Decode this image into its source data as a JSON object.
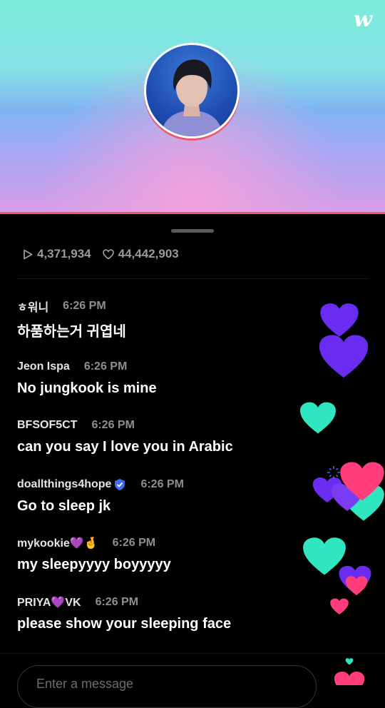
{
  "app": {
    "logo": "w"
  },
  "stats": {
    "plays": "4,371,934",
    "likes": "44,442,903"
  },
  "messages": [
    {
      "user": "ㅎ워니",
      "time": "6:26 PM",
      "text": "하품하는거 귀엽네"
    },
    {
      "user": "Jeon Ispa",
      "time": "6:26 PM",
      "text": "No jungkook is mine"
    },
    {
      "user": "BFSOF5CT",
      "time": "6:26 PM",
      "text": "can you say I love you in Arabic"
    },
    {
      "user": "doallthings4hope",
      "time": "6:26 PM",
      "text": "Go to sleep jk",
      "badge": "verified-badge-icon"
    },
    {
      "user": "mykookie💜🤞",
      "time": "6:26 PM",
      "text": "my sleepyyyy boyyyyy"
    },
    {
      "user": "PRIYA💜VK",
      "time": "6:26 PM",
      "text": "please show your sleeping face"
    }
  ],
  "input": {
    "placeholder": "Enter a message"
  },
  "colors": {
    "banner_border": "#e85a6d",
    "heart_purple": "#6a2cf0",
    "heart_teal": "#2fe6c0",
    "heart_pink": "#ff3d8a"
  }
}
